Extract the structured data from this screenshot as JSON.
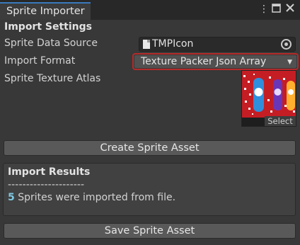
{
  "window": {
    "tab_title": "Sprite Importer",
    "icons": [
      "more-vert-icon",
      "maximize-icon",
      "close-icon"
    ],
    "accent_color": "#3a79bb"
  },
  "import_settings": {
    "header": "Import Settings",
    "sprite_data_source": {
      "label": "Sprite Data Source",
      "value": "TMPIcon"
    },
    "import_format": {
      "label": "Import Format",
      "value": "Texture Packer Json Array",
      "highlight_color": "#b52a2a"
    },
    "sprite_texture_atlas": {
      "label": "Sprite Texture Atlas",
      "select_label": "Select"
    }
  },
  "create_button": "Create Sprite Asset",
  "results": {
    "title": "Import Results",
    "divider": "---------------------",
    "count": "5",
    "message": " Sprites were imported from file."
  },
  "save_button": "Save Sprite Asset"
}
